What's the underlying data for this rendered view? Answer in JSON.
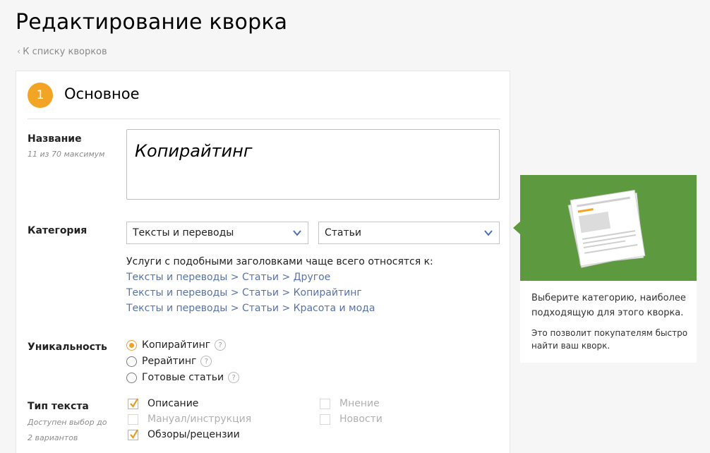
{
  "page": {
    "title": "Редактирование кворка"
  },
  "nav": {
    "back_label": "К списку кворков"
  },
  "section": {
    "number": "1",
    "title": "Основное"
  },
  "name_field": {
    "label": "Название",
    "hint": "11 из 70 максимум",
    "value": "Копирайтинг"
  },
  "category": {
    "label": "Категория",
    "primary_value": "Тексты и переводы",
    "secondary_value": "Статьи",
    "suggest_intro": "Услуги с подобными заголовками чаще всего относятся к:",
    "suggestions": [
      "Тексты и переводы > Статьи > Другое",
      "Тексты и переводы > Статьи > Копирайтинг",
      "Тексты и переводы > Статьи > Красота и мода"
    ]
  },
  "uniqueness": {
    "label": "Уникальность",
    "options": [
      {
        "label": "Копирайтинг",
        "selected": true
      },
      {
        "label": "Рерайтинг",
        "selected": false
      },
      {
        "label": "Готовые статьи",
        "selected": false
      }
    ],
    "help_glyph": "?"
  },
  "text_type": {
    "label": "Тип текста",
    "hint_line1": "Доступен выбор до",
    "hint_line2": "2 вариантов",
    "options": [
      {
        "label": "Описание",
        "checked": true,
        "disabled": false
      },
      {
        "label": "Мануал/инструкция",
        "checked": false,
        "disabled": true
      },
      {
        "label": "Обзоры/рецензии",
        "checked": true,
        "disabled": false
      },
      {
        "label": "Мнение",
        "checked": false,
        "disabled": true
      },
      {
        "label": "Новости",
        "checked": false,
        "disabled": true
      }
    ]
  },
  "sidebar": {
    "text1": "Выберите категорию, наиболее подходящую для этого кворка.",
    "text2": "Это позволит покупателям быстро найти ваш кворк."
  },
  "colors": {
    "accent_orange": "#f2a524",
    "link_blue": "#5973a8",
    "sidebar_green": "#5d9a3f"
  }
}
